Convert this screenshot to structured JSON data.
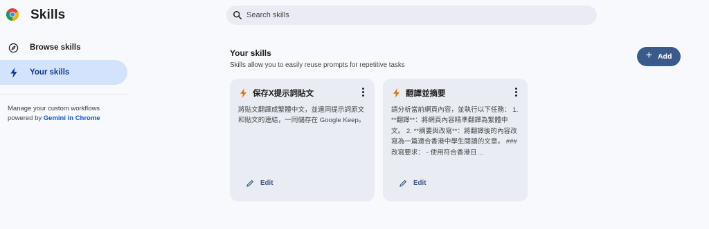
{
  "app": {
    "title": "Skills",
    "logo_icon": "chrome-icon"
  },
  "search": {
    "placeholder": "Search skills",
    "value": ""
  },
  "sidebar": {
    "items": [
      {
        "label": "Browse skills",
        "icon": "compass-icon",
        "active": false
      },
      {
        "label": "Your skills",
        "icon": "bolt-icon",
        "active": true
      }
    ],
    "note_text": "Manage your custom workflows powered by ",
    "note_link": "Gemini in Chrome"
  },
  "main": {
    "title": "Your skills",
    "subtitle": "Skills allow you to easily reuse prompts for repetitive tasks",
    "add_label": "Add",
    "cards": [
      {
        "title": "保存X提示詞貼文",
        "body": "將貼文翻譯成繁體中文，並連同提示詞原文和貼文的連結，一同儲存在 Google Keep。",
        "edit_label": "Edit"
      },
      {
        "title": "翻譯並摘要",
        "body": "請分析當前網頁內容，並執行以下任務： 1. **翻譯**：將網頁內容精準翻譯為繁體中文。 2. **摘要與改寫**：將翻譯後的內容改寫為一篇適合香港中學生閱讀的文章。 ### 改寫要求： - 使用符合香港日…",
        "edit_label": "Edit"
      }
    ]
  },
  "colors": {
    "accent": "#3a5a8c",
    "active_nav_bg": "#d3e3fd",
    "card_bg": "#e9ecf2",
    "bolt": "#e8710a",
    "link": "#0b57d0"
  }
}
